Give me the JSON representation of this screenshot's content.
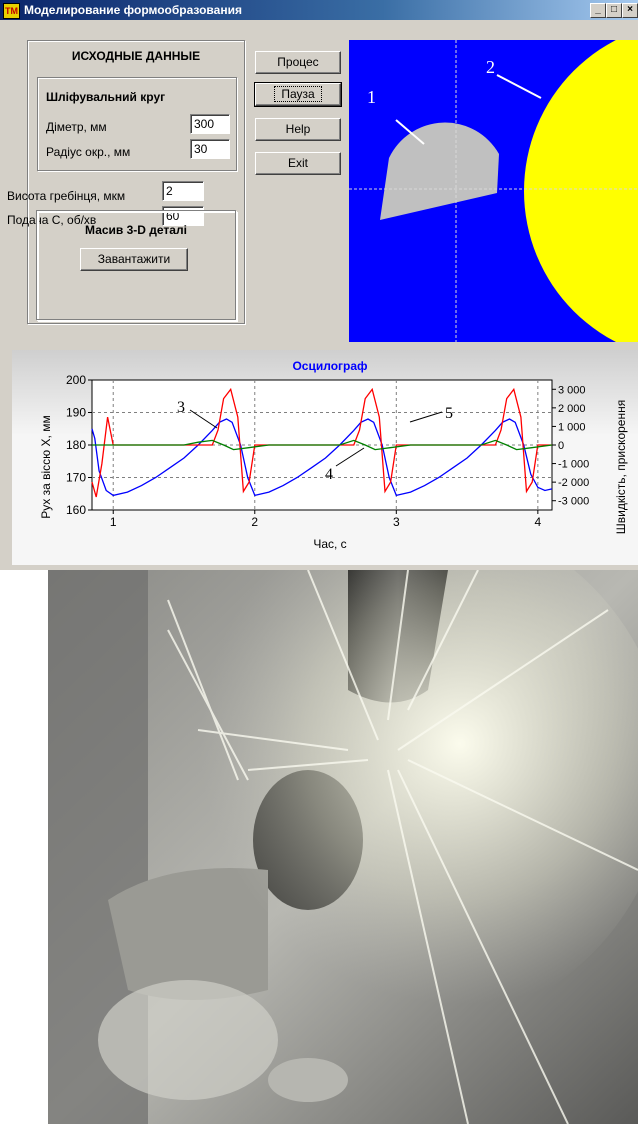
{
  "window": {
    "title": "Моделирование формообразования",
    "icon_label": "ТМ",
    "caption_buttons": [
      "_",
      "□",
      "×"
    ]
  },
  "left_panel": {
    "section_title": "ИСХОДНЫЕ ДАННЫЕ",
    "wheel_group": {
      "title": "Шліфувальний круг",
      "diameter_label": "Діметр, мм",
      "diameter_value": "300",
      "radius_label": "Радіус окр., мм",
      "radius_value": "30"
    },
    "height_label": "Висота гребінця, мкм",
    "height_value": "2",
    "feed_label": "Подача С, об/хв",
    "feed_value": "60",
    "model_group": {
      "title": "Масив 3-D деталі",
      "load_button": "Завантажити"
    }
  },
  "buttons": {
    "process": "Процес",
    "pause": "Пауза",
    "help": "Help",
    "exit": "Exit"
  },
  "simulation": {
    "label_workpiece": "1",
    "label_wheel": "2",
    "background_color": "#0000ff",
    "wheel_color": "#ffff00",
    "workpiece_color": "#c0c0c0"
  },
  "chart_data": {
    "type": "line",
    "title": "Осцилограф",
    "xlabel": "Час, с",
    "ylabel": "Рух за віссю X, мм",
    "y2label": "Швидкість, прискорення",
    "xlim": [
      0.85,
      4.1
    ],
    "ylim": [
      160,
      200
    ],
    "y2lim": [
      -3500,
      3500
    ],
    "xticks": [
      "1",
      "2",
      "3",
      "4"
    ],
    "yticks": [
      "160",
      "170",
      "180",
      "190",
      "200"
    ],
    "y2ticks": [
      "-3 000",
      "-2 000",
      "-1 000",
      "0",
      "1 000",
      "2 000",
      "3 000"
    ],
    "grid": true,
    "annotations": [
      "3",
      "4",
      "5"
    ],
    "series": [
      {
        "axis": "left",
        "color": "#0000ff",
        "x": [
          0.85,
          0.87,
          0.9,
          0.95,
          1.0,
          1.1,
          1.2,
          1.3,
          1.4,
          1.5,
          1.6,
          1.7,
          1.75,
          1.8,
          1.84,
          1.9,
          1.95,
          2.0,
          2.1,
          2.2,
          2.3,
          2.4,
          2.5,
          2.6,
          2.7,
          2.75,
          2.8,
          2.84,
          2.9,
          2.95,
          3.0,
          3.1,
          3.2,
          3.3,
          3.4,
          3.5,
          3.6,
          3.7,
          3.75,
          3.8,
          3.84,
          3.9,
          3.95,
          4.0,
          4.05,
          4.1
        ],
        "values": [
          185,
          182,
          172,
          166,
          164.5,
          165.5,
          167.5,
          170,
          173,
          176,
          180,
          184.5,
          187,
          188,
          187,
          180,
          170,
          164.5,
          165.5,
          167.5,
          170,
          173,
          176,
          180,
          184.5,
          187,
          188,
          187,
          180,
          170,
          164.5,
          165.5,
          167.5,
          170,
          173,
          176,
          180,
          184.5,
          187,
          188,
          187,
          180,
          171,
          167,
          166,
          166.5
        ]
      },
      {
        "axis": "right",
        "color": "#ff0000",
        "x": [
          0.85,
          0.88,
          0.92,
          0.96,
          1.0,
          1.05,
          1.3,
          1.5,
          1.62,
          1.7,
          1.74,
          1.78,
          1.83,
          1.88,
          1.92,
          1.96,
          2.0,
          2.05,
          2.3,
          2.5,
          2.62,
          2.7,
          2.74,
          2.78,
          2.83,
          2.88,
          2.92,
          2.96,
          3.0,
          3.05,
          3.3,
          3.5,
          3.62,
          3.7,
          3.74,
          3.78,
          3.83,
          3.88,
          3.92,
          3.96,
          4.0,
          4.05,
          4.1
        ],
        "values": [
          -2000,
          -2800,
          -1000,
          1500,
          0,
          0,
          0,
          0,
          0,
          0,
          800,
          2500,
          3000,
          1500,
          -2500,
          -2000,
          0,
          0,
          0,
          0,
          0,
          0,
          800,
          2500,
          3000,
          1500,
          -2500,
          -2000,
          0,
          0,
          0,
          0,
          0,
          0,
          800,
          2500,
          3000,
          1500,
          -2500,
          -2000,
          0,
          0,
          0
        ]
      },
      {
        "axis": "right",
        "color": "#008000",
        "x": [
          0.85,
          1.0,
          1.5,
          1.6,
          1.7,
          1.78,
          1.85,
          1.95,
          2.1,
          2.6,
          2.7,
          2.78,
          2.85,
          2.95,
          3.1,
          3.6,
          3.7,
          3.78,
          3.85,
          3.95,
          4.1
        ],
        "values": [
          0,
          0,
          0,
          150,
          250,
          0,
          -250,
          -150,
          0,
          0,
          250,
          0,
          -250,
          -150,
          0,
          0,
          250,
          0,
          -250,
          -150,
          0
        ]
      }
    ]
  }
}
